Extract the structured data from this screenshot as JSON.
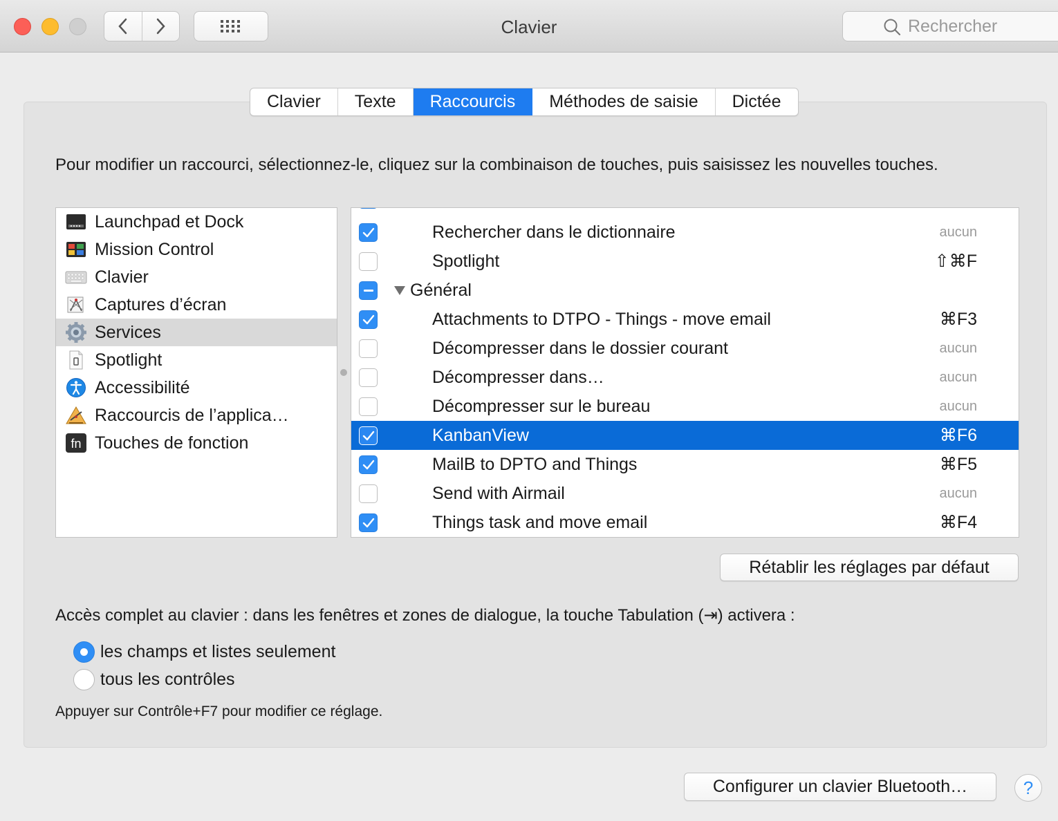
{
  "window": {
    "title": "Clavier",
    "search_placeholder": "Rechercher"
  },
  "tabs": [
    {
      "label": "Clavier",
      "active": false
    },
    {
      "label": "Texte",
      "active": false
    },
    {
      "label": "Raccourcis",
      "active": true
    },
    {
      "label": "Méthodes de saisie",
      "active": false
    },
    {
      "label": "Dictée",
      "active": false
    }
  ],
  "instructions": "Pour modifier un raccourci, sélectionnez-le, cliquez sur la combinaison de touches, puis saisissez les nouvelles touches.",
  "categories": [
    {
      "label": "Launchpad et Dock",
      "icon": "launchpad-icon",
      "selected": false
    },
    {
      "label": "Mission Control",
      "icon": "mission-control-icon",
      "selected": false
    },
    {
      "label": "Clavier",
      "icon": "keyboard-icon",
      "selected": false
    },
    {
      "label": "Captures d’écran",
      "icon": "screenshot-icon",
      "selected": false
    },
    {
      "label": "Services",
      "icon": "gear-icon",
      "selected": true
    },
    {
      "label": "Spotlight",
      "icon": "spotlight-icon",
      "selected": false
    },
    {
      "label": "Accessibilité",
      "icon": "accessibility-icon",
      "selected": false
    },
    {
      "label": "Raccourcis de l’applica…",
      "icon": "app-shortcuts-icon",
      "selected": false
    },
    {
      "label": "Touches de fonction",
      "icon": "fn-key-icon",
      "selected": false
    }
  ],
  "shortcuts": [
    {
      "label": "Rechercher dans le dictionnaire",
      "key": "aucun",
      "checked": true
    },
    {
      "label": "Spotlight",
      "key": "⇧⌘F",
      "checked": false
    },
    {
      "group": "Général",
      "state": "mixed"
    },
    {
      "label": "Attachments to DTPO - Things - move email",
      "key": "⌘F3",
      "checked": true
    },
    {
      "label": "Décompresser dans le dossier courant",
      "key": "aucun",
      "checked": false
    },
    {
      "label": "Décompresser dans…",
      "key": "aucun",
      "checked": false
    },
    {
      "label": "Décompresser sur le bureau",
      "key": "aucun",
      "checked": false
    },
    {
      "label": "KanbanView",
      "key": "⌘F6",
      "checked": true,
      "selected": true
    },
    {
      "label": "MailB to DPTO and Things",
      "key": "⌘F5",
      "checked": true
    },
    {
      "label": "Send with Airmail",
      "key": "aucun",
      "checked": false
    },
    {
      "label": "Things task and move email",
      "key": "⌘F4",
      "checked": true
    }
  ],
  "reset_button": "Rétablir les réglages par défaut",
  "keyboard_access": {
    "text": "Accès complet au clavier : dans les fenêtres et zones de dialogue, la touche Tabulation (⇥) activera :",
    "options": [
      {
        "label": "les champs et listes seulement",
        "selected": true
      },
      {
        "label": "tous les contrôles",
        "selected": false
      }
    ],
    "hint": "Appuyer sur Contrôle+F7 pour modifier ce réglage."
  },
  "bluetooth_button": "Configurer un clavier Bluetooth…",
  "help_button": "?"
}
